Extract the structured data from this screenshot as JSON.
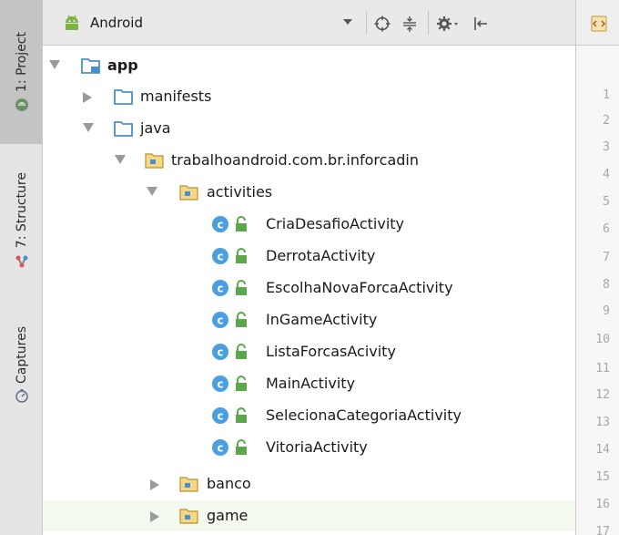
{
  "tool_strip": {
    "tabs": [
      {
        "label": "1: Project",
        "icon": "android-icon",
        "active": true
      },
      {
        "label": "7: Structure",
        "icon": "structure-icon",
        "active": false
      },
      {
        "label": "Captures",
        "icon": "captures-icon",
        "active": false
      }
    ]
  },
  "header": {
    "view_selector": "Android",
    "icons": [
      "sync-target-icon",
      "collapse-all-icon",
      "settings-gear-icon",
      "hide-panel-icon",
      "editor-tab-icon"
    ]
  },
  "tree": {
    "app": "app",
    "manifests": "manifests",
    "java": "java",
    "package": "trabalhoandroid.com.br.inforcadin",
    "activities": "activities",
    "classes": [
      "CriaDesafioActivity",
      "DerrotaActivity",
      "EscolhaNovaForcaActivity",
      "InGameActivity",
      "ListaForcasAcivity",
      "MainActivity",
      "SelecionaCategoriaActivity",
      "VitoriaActivity"
    ],
    "banco": "banco",
    "game": "game"
  },
  "gutter": {
    "line_numbers": [
      "1",
      "2",
      "3",
      "4",
      "5",
      "6",
      "7",
      "8",
      "9",
      "10",
      "11",
      "12",
      "13",
      "14",
      "15",
      "16",
      "17"
    ]
  },
  "colors": {
    "folder_blue": "#4a90c8",
    "class_circle": "#4a9fe0",
    "lock_green": "#5aa84a",
    "android_green": "#7cb342"
  }
}
